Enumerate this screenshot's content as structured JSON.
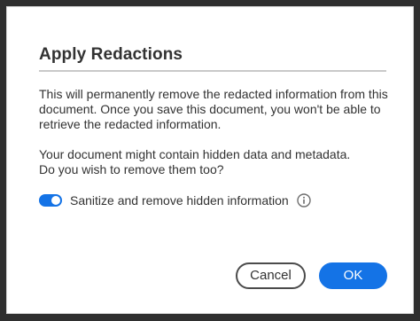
{
  "dialog": {
    "title": "Apply Redactions",
    "paragraph1": {
      "line1": "This will permanently remove the redacted information from this",
      "line2": "document. Once you save this document, you won't be able to",
      "line3": "retrieve the redacted information."
    },
    "paragraph2": {
      "line1": "Your document might contain hidden data and metadata.",
      "line2": "Do you wish to remove them too?"
    },
    "toggle": {
      "label": "Sanitize and remove hidden information",
      "checked": true,
      "icon": "info-icon"
    },
    "buttons": {
      "cancel": "Cancel",
      "ok": "OK"
    }
  },
  "colors": {
    "accent": "#1473e6",
    "text": "#323232",
    "divider": "#c9c9c9"
  }
}
